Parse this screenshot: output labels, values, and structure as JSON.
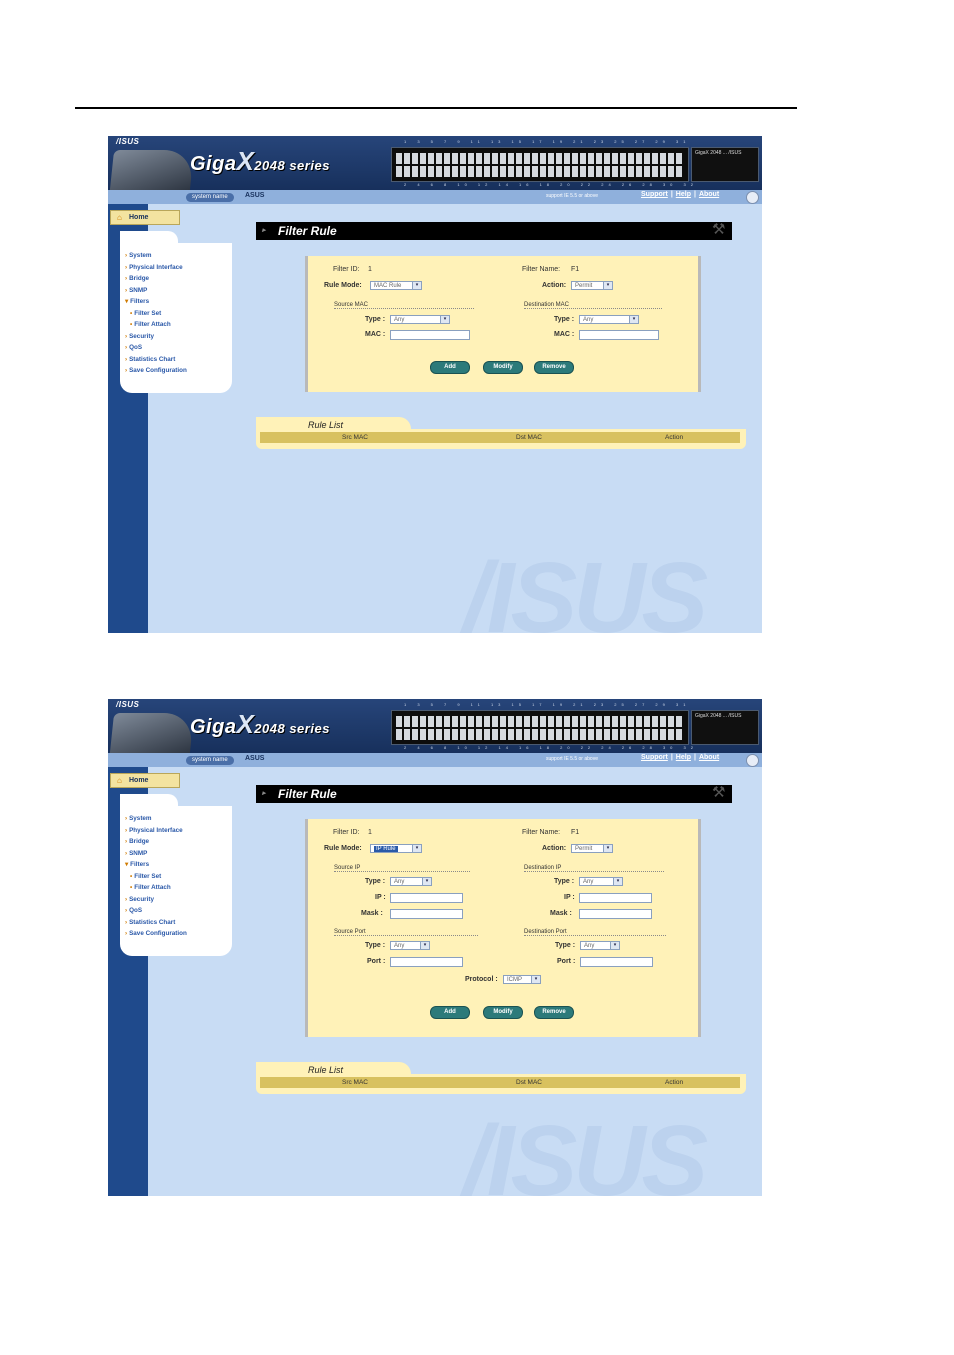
{
  "header": {
    "brand": "/ISUS",
    "product_giga": "Giga",
    "product_x": "X",
    "product_series": "2048 series",
    "ports_top": "1 3 5 7 9 11 13 15 17 19 21 23 25 27 29 31 33 35 37 39 41 43 45 47",
    "ports_bottom": "2 4 6 8 10 12 14 16 18 20 22 24 26 28 30 32 34 36 38 40 42 44 46 48",
    "panel_brand": "GigaX 2048 ... /ISUS",
    "system_name_label": "system name",
    "system_name_value": "ASUS",
    "support_note": "support IE 5.5 or above",
    "link_support": "Support",
    "link_help": "Help",
    "link_about": "About"
  },
  "sidebar": {
    "home": "Home",
    "items": [
      "System",
      "Physical Interface",
      "Bridge",
      "SNMP",
      "Filters",
      "Filter Set",
      "Filter Attach",
      "Security",
      "QoS",
      "Statistics Chart",
      "Save Configuration"
    ]
  },
  "page_title": "Filter Rule",
  "form": {
    "filter_id_label": "Filter ID:",
    "filter_id_value": "1",
    "filter_name_label": "Filter Name:",
    "filter_name_value": "F1",
    "rule_mode_label": "Rule Mode:",
    "action_label": "Action:",
    "action_value": "Permit",
    "type_label": "Type :",
    "type_value": "Any",
    "mac_label": "MAC :",
    "ip_label": "IP :",
    "mask_label": "Mask :",
    "port_label": "Port :",
    "protocol_label": "Protocol :",
    "protocol_value": "ICMP"
  },
  "mac_view": {
    "rule_mode_value": "MAC Rule",
    "source_section": "Source MAC",
    "dest_section": "Destination MAC"
  },
  "ip_view": {
    "rule_mode_value": "IP Rule",
    "source_ip_section": "Source IP",
    "dest_ip_section": "Destination IP",
    "source_port_section": "Source Port",
    "dest_port_section": "Destination Port"
  },
  "buttons": {
    "add": "Add",
    "modify": "Modify",
    "remove": "Remove"
  },
  "rule_list": {
    "title": "Rule List",
    "columns": [
      "Src MAC",
      "Dst MAC",
      "Action"
    ]
  },
  "watermark": "/ISUS"
}
